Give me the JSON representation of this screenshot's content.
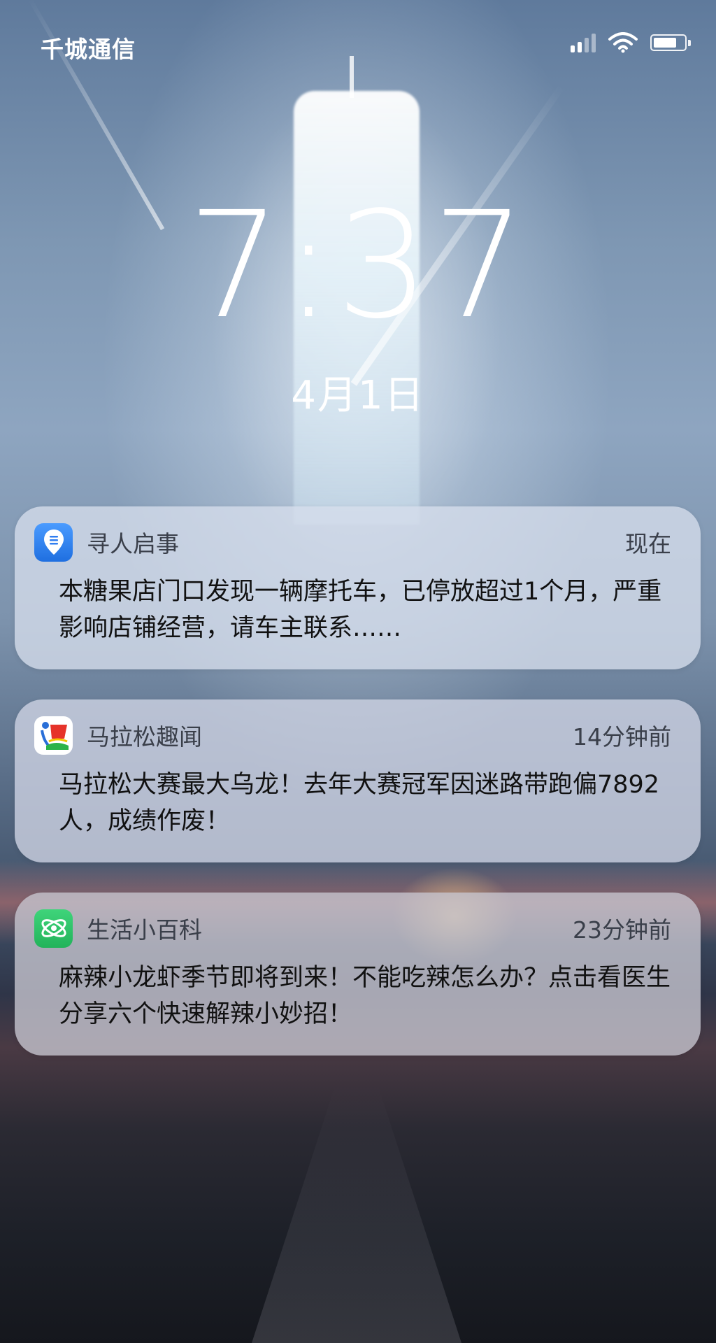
{
  "status_bar": {
    "carrier": "千城通信",
    "signal_icon": "signal-icon",
    "signal_level": 2,
    "wifi_icon": "wifi-icon",
    "battery_icon": "battery-icon",
    "battery_level": 0.75
  },
  "lock_screen": {
    "time": "7:37",
    "date": "4月1日"
  },
  "notifications": [
    {
      "app_name": "寻人启事",
      "time": "现在",
      "body": "本糖果店门口发现一辆摩托车，已停放超过1个月，严重影响店铺经营，请车主联系……",
      "icon": "map-pin-icon",
      "icon_color": "#2f7df0"
    },
    {
      "app_name": "马拉松趣闻",
      "time": "14分钟前",
      "body": "马拉松大赛最大乌龙！去年大赛冠军因迷路带跑偏7892人，成绩作废！",
      "icon": "marathon-logo-icon",
      "icon_color": "#e6332a"
    },
    {
      "app_name": "生活小百科",
      "time": "23分钟前",
      "body": "麻辣小龙虾季节即将到来！不能吃辣怎么办？点击看医生分享六个快速解辣小妙招！",
      "icon": "atom-icon",
      "icon_color": "#2ec86c"
    }
  ]
}
